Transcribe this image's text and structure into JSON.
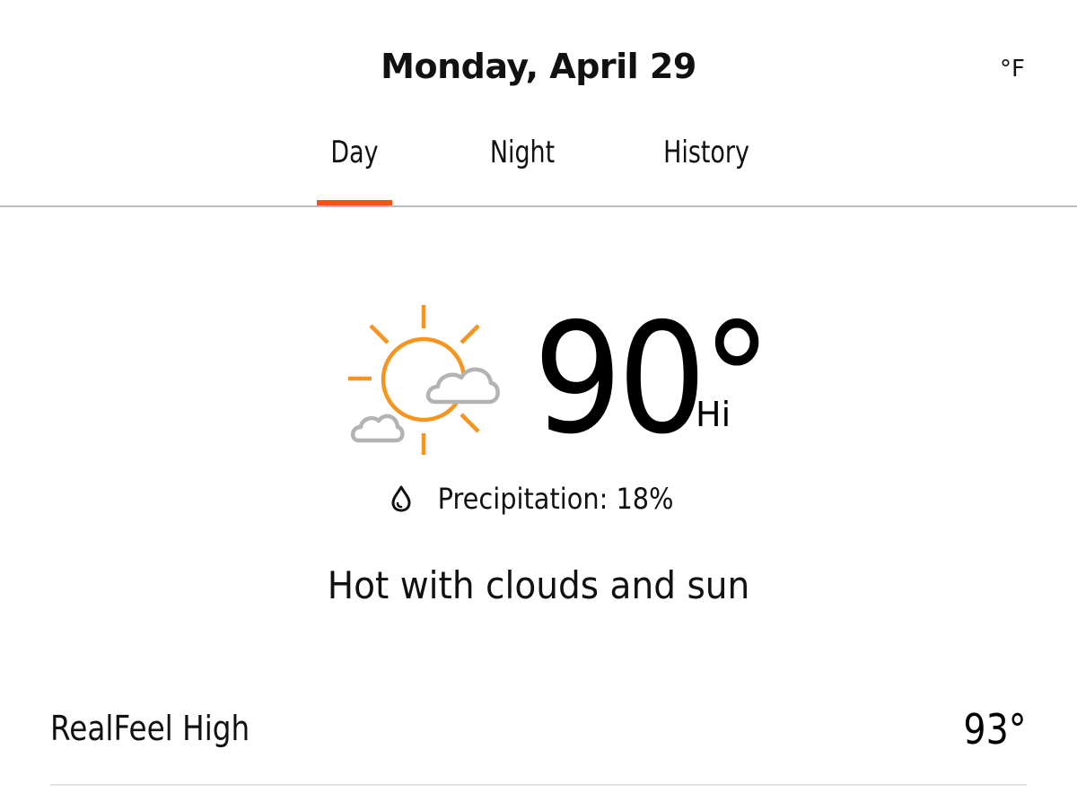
{
  "header": {
    "title": "Monday, April 29",
    "unit": "°F"
  },
  "tabs": [
    {
      "label": "Day",
      "active": true
    },
    {
      "label": "Night",
      "active": false
    },
    {
      "label": "History",
      "active": false
    }
  ],
  "colors": {
    "accent": "#f05514",
    "sun": "#f7941d",
    "cloud": "#b3b3b3"
  },
  "forecast": {
    "icon": "partly-sunny-icon",
    "temperature": "90°",
    "temperature_label": "Hi",
    "precipitation_icon": "droplet-icon",
    "precipitation": "Precipitation: 18%",
    "phrase": "Hot with clouds and sun"
  },
  "details": [
    {
      "label": "RealFeel High",
      "value": "93°"
    }
  ]
}
